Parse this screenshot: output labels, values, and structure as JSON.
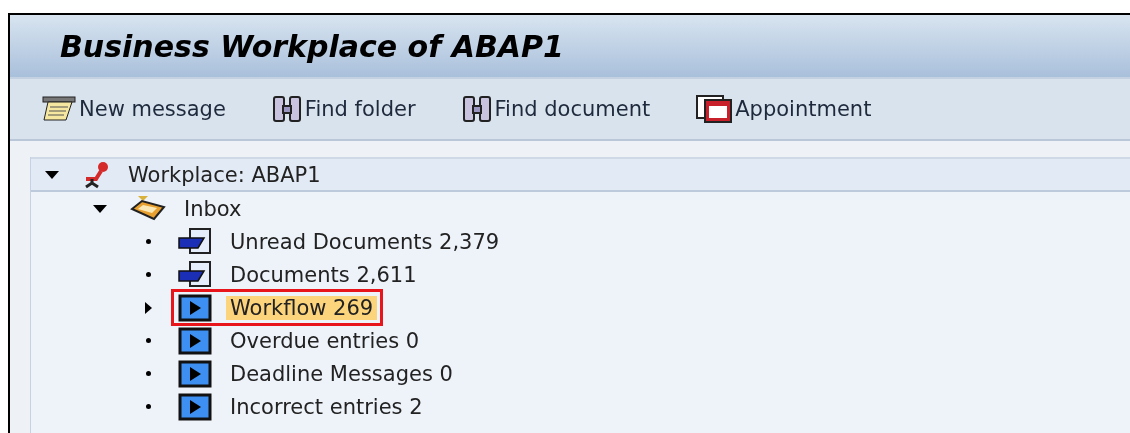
{
  "window": {
    "title": "Business Workplace of ABAP1"
  },
  "toolbar": [
    {
      "label": "New message",
      "kind": "compose"
    },
    {
      "label": "Find folder",
      "kind": "find"
    },
    {
      "label": "Find document",
      "kind": "find"
    },
    {
      "label": "Appointment",
      "kind": "calendar"
    }
  ],
  "tree": [
    {
      "label": "Workplace: ABAP1",
      "kind": "workplace",
      "expanded": true,
      "selected": false,
      "children": [
        {
          "label": "Inbox",
          "kind": "inbox",
          "expanded": true,
          "selected": false,
          "children": [
            {
              "label": "Unread Documents 2,379",
              "kind": "documents",
              "selected": false
            },
            {
              "label": "Documents 2,611",
              "kind": "documents",
              "selected": false
            },
            {
              "label": "Workflow 269",
              "kind": "workflow",
              "expanded": false,
              "selected": true
            },
            {
              "label": "Overdue entries 0",
              "kind": "workflow",
              "selected": false
            },
            {
              "label": "Deadline Messages 0",
              "kind": "workflow",
              "selected": false
            },
            {
              "label": "Incorrect entries 2",
              "kind": "workflow",
              "selected": false
            }
          ]
        }
      ]
    }
  ]
}
